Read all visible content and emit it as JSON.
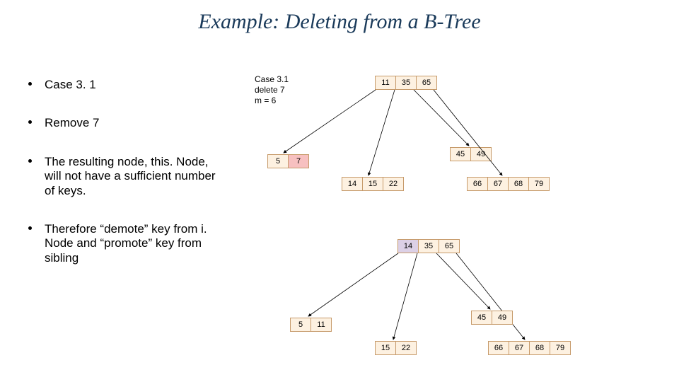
{
  "title": "Example: Deleting from a B-Tree",
  "bullets": [
    "Case 3. 1",
    "Remove 7",
    "The resulting node, this. Node, will not have a sufficient number of keys.",
    "Therefore “demote” key from i. Node and “promote” key from sibling"
  ],
  "diagram1": {
    "annotation": "Case 3.1\ndelete 7\nm = 6",
    "root": [
      "11",
      "35",
      "65"
    ],
    "level1": {
      "a": [
        "5",
        "7"
      ],
      "b": [
        "45",
        "49"
      ]
    },
    "level2": {
      "c": [
        "14",
        "15",
        "22"
      ],
      "d": [
        "66",
        "67",
        "68",
        "79"
      ]
    },
    "highlight_cell": "7"
  },
  "diagram2": {
    "root": [
      "14",
      "35",
      "65"
    ],
    "level1": {
      "a": [
        "5",
        "11"
      ],
      "b": [
        "45",
        "49"
      ]
    },
    "level2": {
      "c": [
        "15",
        "22"
      ],
      "d": [
        "66",
        "67",
        "68",
        "79"
      ]
    },
    "promoted_cell": "14"
  }
}
